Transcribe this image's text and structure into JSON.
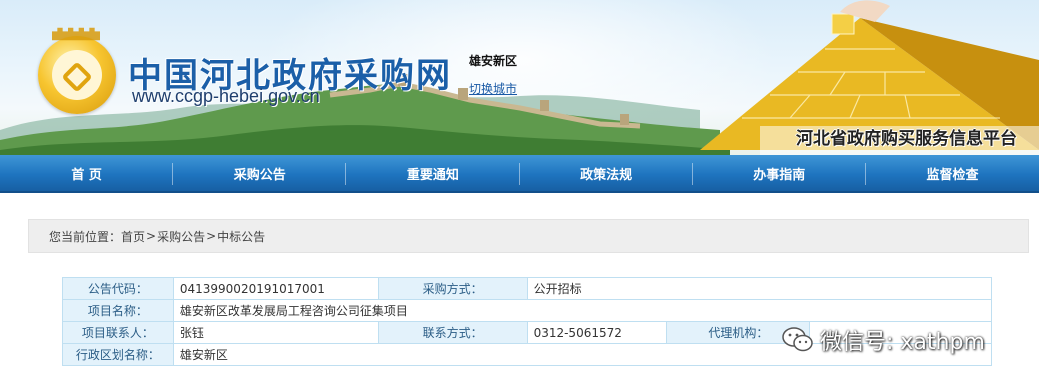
{
  "header": {
    "site_title": "中国河北政府采购网",
    "site_url": "www.ccgp-hebei.gov.cn",
    "region": "雄安新区",
    "switch_city": "切换城市",
    "platform_name": "河北省政府购买服务信息平台"
  },
  "nav": {
    "items": [
      "首 页",
      "采购公告",
      "重要通知",
      "政策法规",
      "办事指南",
      "监督检查"
    ]
  },
  "breadcrumb": {
    "prefix": "您当前位置：",
    "items": [
      "首页",
      "采购公告",
      "中标公告"
    ],
    "separator": ">"
  },
  "info": {
    "rows": [
      {
        "l1": "公告代码：",
        "v1": "041399002019101700l",
        "l2": "采购方式：",
        "v2": "公开招标"
      },
      {
        "l1": "项目名称：",
        "v1": "雄安新区改革发展局工程咨询公司征集项目"
      },
      {
        "l1": "项目联系人：",
        "v1": "张钰",
        "l2": "联系方式：",
        "v2": "0312-5061572",
        "l3": "代理机构：",
        "v3": ""
      },
      {
        "l1": "行政区划名称：",
        "v1": "雄安新区"
      }
    ]
  },
  "watermark": {
    "text": "微信号: xathpm",
    "icon": "wechat-icon"
  },
  "colors": {
    "nav_blue": "#1e74bf",
    "label_bg": "#e3f2fb",
    "title_blue": "#1b5fa8",
    "gold": "#e0a40f"
  }
}
